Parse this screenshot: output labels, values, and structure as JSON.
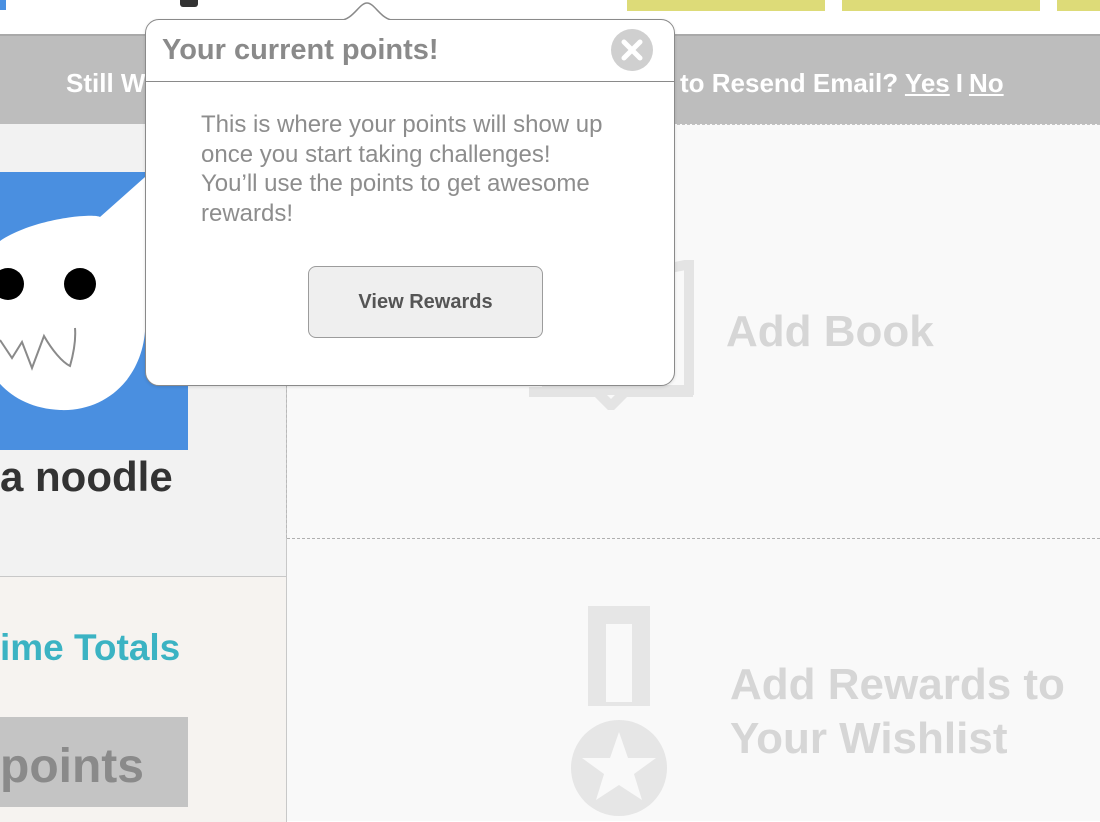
{
  "header": {
    "accent_blue": "#4a90e2",
    "nav_button_color": "#dddb78"
  },
  "notice_bar": {
    "left_text": "Still W",
    "right_prefix": "to Resend Email?",
    "yes_label": "Yes",
    "separator": "I",
    "no_label": "No",
    "background": "#bdbdbd"
  },
  "sidebar": {
    "avatar_icon": "cat-face-avatar",
    "avatar_color": "#4a8fe0",
    "user_name": "a noodle",
    "totals_title": "ime Totals",
    "totals_title_color": "#3bb3c3",
    "points_label": "points"
  },
  "main": {
    "add_book_label": "Add Book",
    "add_book_icon": "book-icon",
    "add_rewards_lines": [
      "Add Rewards to",
      "Your Wishlist"
    ],
    "add_rewards_icon": "medal-star-icon"
  },
  "popup": {
    "title": "Your current points!",
    "close_icon": "close-icon",
    "body_lines": [
      "This is where your points will show up",
      "once you start taking challenges!",
      "You’ll use the points to get awesome",
      "rewards!"
    ],
    "button_label": "View Rewards"
  }
}
